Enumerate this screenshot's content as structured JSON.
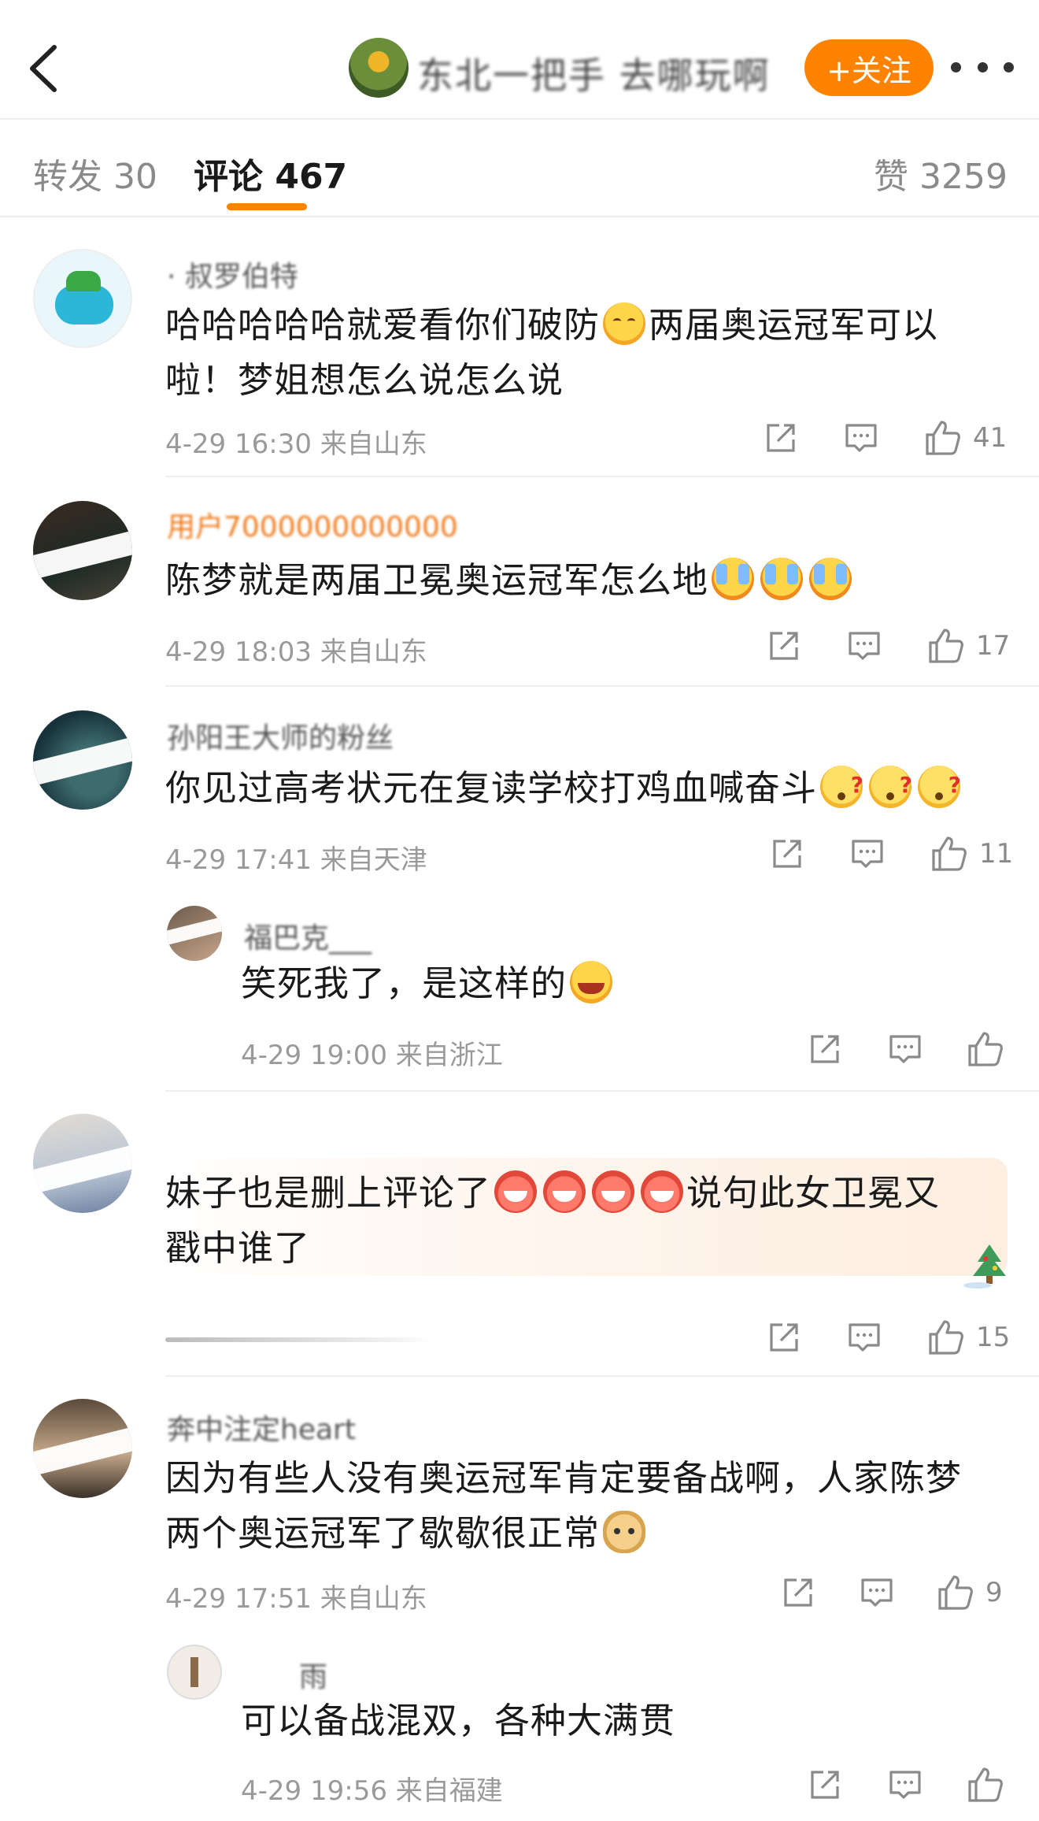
{
  "header": {
    "title": "东北一把手 去哪玩啊",
    "follow_label": "+关注"
  },
  "tabs": {
    "repost": {
      "label": "转发",
      "count": "30"
    },
    "comment": {
      "label": "评论",
      "count": "467"
    },
    "like": {
      "label": "赞",
      "count": "3259"
    }
  },
  "accent_color": "#ff8200",
  "comments": [
    {
      "username": "·  叔罗伯特",
      "text_lines": [
        "哈哈哈哈哈就爱看你们破防",
        "两届奥运冠军可以",
        "啦！梦姐想怎么说怎么说"
      ],
      "time": "4-29 16:30",
      "location": "来自山东",
      "likes": "41"
    },
    {
      "username": "用户7000000000000",
      "text_lines": [
        "陈梦就是两届卫冕奥运冠军怎么地"
      ],
      "time": "4-29 18:03",
      "location": "来自山东",
      "likes": "17"
    },
    {
      "username": "孙阳王大师的粉丝",
      "text_lines": [
        "你见过高考状元在复读学校打鸡血喊奋斗"
      ],
      "time": "4-29 17:41",
      "location": "来自天津",
      "likes": "11",
      "reply": {
        "username": "福巴克___",
        "text": "笑死我了，是这样的",
        "time": "4-29 19:00",
        "location": "来自浙江"
      }
    },
    {
      "username": "",
      "text_lines": [
        "妹子也是删上评论了",
        "说句此女卫冕又",
        "戳中谁了"
      ],
      "time": "",
      "location": "",
      "likes": "15"
    },
    {
      "username": "奔中注定heart",
      "text_lines": [
        "因为有些人没有奥运冠军肯定要备战啊，人家陈梦",
        "两个奥运冠军了歇歇很正常"
      ],
      "time": "4-29 17:51",
      "location": "来自山东",
      "likes": "9",
      "reply": {
        "username": "雨",
        "text": "可以备战混双，各种大满贯",
        "time": "4-29 19:56",
        "location": "来自福建"
      }
    }
  ],
  "icons": [
    "back-icon",
    "more-icon",
    "share-icon",
    "comment-icon",
    "like-icon"
  ]
}
